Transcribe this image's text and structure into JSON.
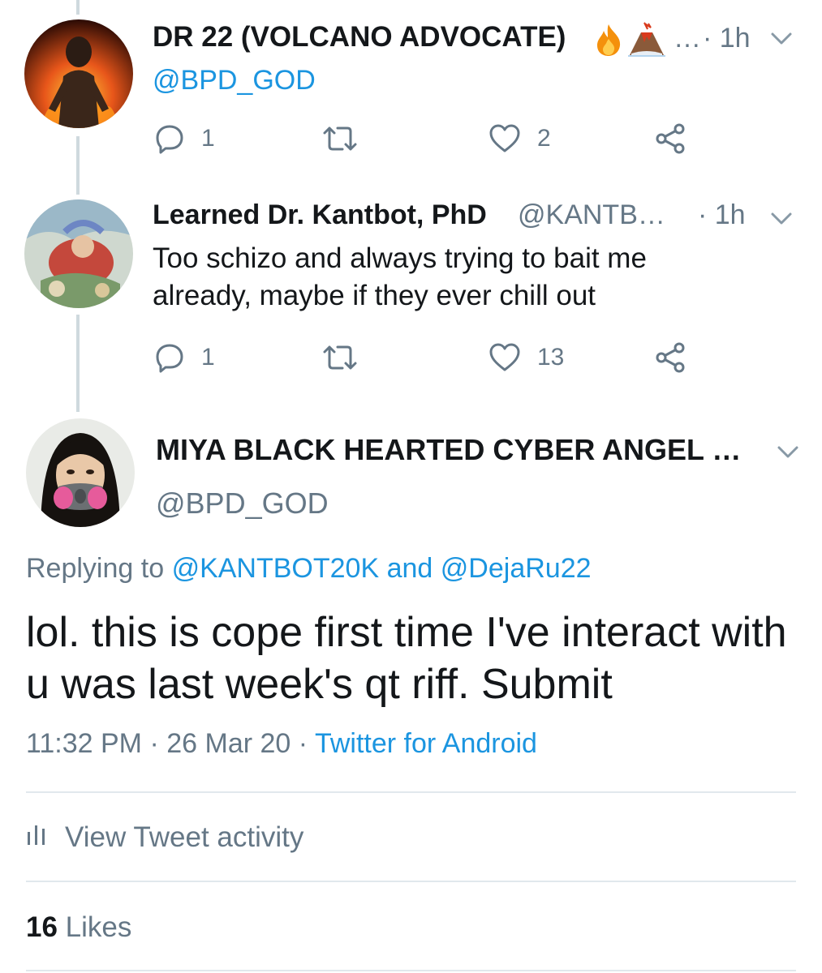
{
  "tweets": [
    {
      "name": "DR 22 (VOLCANO ADVOCATE)",
      "emoji": [
        "🔥",
        "🌋"
      ],
      "ellipsis": "…",
      "time": "· 1h",
      "handle": "@BPD_GOD",
      "replies": "1",
      "retweets": "",
      "likes": "2"
    },
    {
      "name": "Learned Dr. Kantbot, PhD",
      "handle": "@KANTB…",
      "time": "· 1h",
      "text": "Too schizo and always trying to bait me already, maybe if they ever chill out",
      "replies": "1",
      "retweets": "",
      "likes": "13"
    }
  ],
  "main_tweet": {
    "name": "MIYA BLACK HEARTED CYBER ANGEL …",
    "handle": "@BPD_GOD",
    "replying_prefix": "Replying to",
    "reply_mention_1": "@KANTBOT20K",
    "reply_and": "and",
    "reply_mention_2": "@DejaRu22",
    "text": "lol. this is cope first time I've interact with u was last week's qt riff. Submit",
    "time": "11:32 PM",
    "date": "26 Mar 20",
    "source": "Twitter for Android",
    "activity_label": "View Tweet activity",
    "likes_count": "16",
    "likes_label": "Likes"
  },
  "colors": {
    "link": "#1b95e0",
    "muted": "#657786",
    "text": "#14171a",
    "divider": "#e1e8ed"
  },
  "icons": [
    "reply-icon",
    "retweet-icon",
    "like-icon",
    "share-icon",
    "chevron-down-icon",
    "analytics-icon"
  ]
}
